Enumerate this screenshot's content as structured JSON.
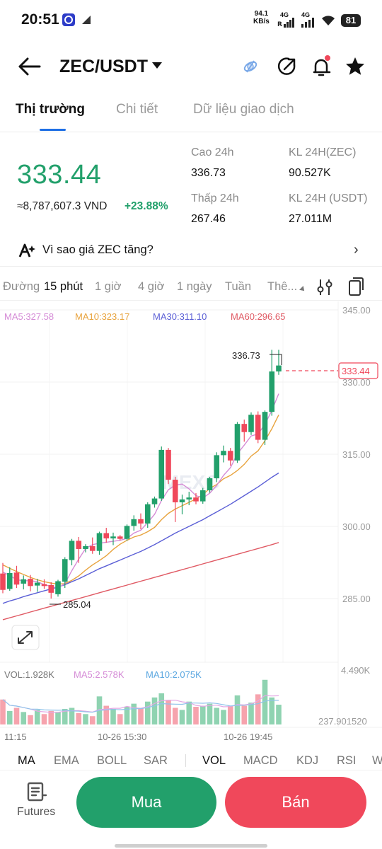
{
  "status_bar": {
    "time": "20:51",
    "net_speed": "94.1",
    "net_unit": "KB/s",
    "sig1": "4G",
    "sig2": "4G",
    "battery": "81"
  },
  "header": {
    "pair": "ZEC/USDT"
  },
  "tabs": [
    {
      "label": "Thị trường"
    },
    {
      "label": "Chi tiết"
    },
    {
      "label": "Dữ liệu giao dịch"
    }
  ],
  "price": {
    "last": "333.44",
    "vnd": "≈8,787,607.3 VND",
    "change": "+23.88%",
    "high_label": "Cao 24h",
    "high": "336.73",
    "low_label": "Thấp 24h",
    "low": "267.46",
    "vol_base_label": "KL 24H(ZEC)",
    "vol_base": "90.527K",
    "vol_quote_label": "KL 24H (USDT)",
    "vol_quote": "27.011M"
  },
  "why_banner": "Vì sao giá ZEC tăng?",
  "intervals": [
    "Đường",
    "15 phút",
    "1 giờ",
    "4 giờ",
    "1 ngày",
    "Tuần",
    "Thê..."
  ],
  "chart_labels": {
    "ma5": "MA5:327.58",
    "ma10": "MA10:323.17",
    "ma30": "MA30:311.10",
    "ma60": "MA60:296.65",
    "high_mark": "336.73",
    "low_mark": "285.04",
    "price_tag": "333.44",
    "vol": "VOL:1.928K",
    "vol_ma5": "MA5:2.578K",
    "vol_ma10": "MA10:2.075K",
    "vol_max": "4.490K",
    "vol_min": "237.901520",
    "watermark": "MEXC"
  },
  "chart_data": {
    "type": "candlestick",
    "y_ticks": [
      "345.00",
      "330.00",
      "315.00",
      "300.00",
      "285.00"
    ],
    "ylim": [
      277.5,
      345
    ],
    "x_ticks": [
      "11:15",
      "10-26 15:30",
      "10-26 19:45"
    ],
    "candles": [
      {
        "o": 290.2,
        "h": 292.4,
        "l": 286.1,
        "c": 286.8
      },
      {
        "o": 287.0,
        "h": 291.5,
        "l": 286.6,
        "c": 290.3
      },
      {
        "o": 290.4,
        "h": 291.8,
        "l": 287.2,
        "c": 287.9
      },
      {
        "o": 288.1,
        "h": 289.8,
        "l": 286.9,
        "c": 289.0
      },
      {
        "o": 289.1,
        "h": 289.9,
        "l": 286.5,
        "c": 287.6
      },
      {
        "o": 287.7,
        "h": 289.1,
        "l": 286.4,
        "c": 288.3
      },
      {
        "o": 288.0,
        "h": 289.0,
        "l": 287.0,
        "c": 287.6
      },
      {
        "o": 287.8,
        "h": 288.4,
        "l": 285.0,
        "c": 286.2
      },
      {
        "o": 285.9,
        "h": 288.9,
        "l": 285.4,
        "c": 288.6
      },
      {
        "o": 288.5,
        "h": 293.6,
        "l": 287.2,
        "c": 293.2
      },
      {
        "o": 293.0,
        "h": 297.4,
        "l": 291.9,
        "c": 297.0
      },
      {
        "o": 297.0,
        "h": 297.8,
        "l": 292.4,
        "c": 295.3
      },
      {
        "o": 295.3,
        "h": 296.3,
        "l": 294.6,
        "c": 295.9
      },
      {
        "o": 295.9,
        "h": 297.7,
        "l": 294.3,
        "c": 294.9
      },
      {
        "o": 294.9,
        "h": 298.9,
        "l": 294.1,
        "c": 298.6
      },
      {
        "o": 298.6,
        "h": 299.7,
        "l": 296.6,
        "c": 297.5
      },
      {
        "o": 297.5,
        "h": 298.7,
        "l": 296.1,
        "c": 297.9
      },
      {
        "o": 297.9,
        "h": 298.2,
        "l": 297.1,
        "c": 297.4
      },
      {
        "o": 297.4,
        "h": 300.4,
        "l": 297.0,
        "c": 300.1
      },
      {
        "o": 300.1,
        "h": 302.3,
        "l": 299.1,
        "c": 301.5
      },
      {
        "o": 301.5,
        "h": 302.7,
        "l": 299.4,
        "c": 300.6
      },
      {
        "o": 300.6,
        "h": 305.0,
        "l": 299.7,
        "c": 304.6
      },
      {
        "o": 304.6,
        "h": 306.2,
        "l": 303.9,
        "c": 305.8
      },
      {
        "o": 305.8,
        "h": 316.6,
        "l": 305.3,
        "c": 315.9
      },
      {
        "o": 315.9,
        "h": 316.3,
        "l": 308.8,
        "c": 309.7
      },
      {
        "o": 309.7,
        "h": 310.3,
        "l": 300.9,
        "c": 305.0
      },
      {
        "o": 305.0,
        "h": 306.6,
        "l": 302.5,
        "c": 305.6
      },
      {
        "o": 305.6,
        "h": 307.2,
        "l": 304.4,
        "c": 306.0
      },
      {
        "o": 306.0,
        "h": 306.9,
        "l": 304.6,
        "c": 305.2
      },
      {
        "o": 305.2,
        "h": 308.0,
        "l": 304.7,
        "c": 307.5
      },
      {
        "o": 307.5,
        "h": 310.3,
        "l": 307.0,
        "c": 310.0
      },
      {
        "o": 310.0,
        "h": 315.4,
        "l": 309.2,
        "c": 314.8
      },
      {
        "o": 314.8,
        "h": 316.8,
        "l": 313.3,
        "c": 315.7
      },
      {
        "o": 315.7,
        "h": 316.3,
        "l": 312.6,
        "c": 313.7
      },
      {
        "o": 313.7,
        "h": 321.7,
        "l": 313.2,
        "c": 321.3
      },
      {
        "o": 321.3,
        "h": 322.2,
        "l": 317.6,
        "c": 319.6
      },
      {
        "o": 319.6,
        "h": 323.7,
        "l": 319.0,
        "c": 323.2
      },
      {
        "o": 323.2,
        "h": 323.9,
        "l": 317.3,
        "c": 318.0
      },
      {
        "o": 318.0,
        "h": 324.1,
        "l": 316.9,
        "c": 323.8
      },
      {
        "o": 323.8,
        "h": 336.7,
        "l": 323.0,
        "c": 332.2
      },
      {
        "o": 332.2,
        "h": 336.7,
        "l": 331.5,
        "c": 333.44
      }
    ],
    "volume": [
      2.4,
      1.3,
      1.6,
      1.2,
      0.9,
      1.4,
      1.0,
      1.3,
      1.2,
      1.5,
      1.6,
      1.1,
      1.0,
      0.8,
      2.7,
      1.8,
      1.5,
      1.0,
      1.7,
      2.0,
      1.6,
      2.2,
      2.6,
      3.0,
      2.3,
      1.6,
      1.4,
      2.2,
      1.7,
      1.8,
      2.0,
      1.6,
      1.4,
      1.8,
      2.8,
      1.8,
      2.1,
      2.9,
      4.3,
      2.6,
      1.9
    ],
    "ma5": [
      290.5,
      289.8,
      288.9,
      288.7,
      288.7,
      288.5,
      287.9,
      287.5,
      287.2,
      288.1,
      290.8,
      293.2,
      295.4,
      296.2,
      296.5,
      296.7,
      296.9,
      297.1,
      297.5,
      298.6,
      299.2,
      300.8,
      302.5,
      305.4,
      307.6,
      308.6,
      308.8,
      307.8,
      306.4,
      305.9,
      306.9,
      308.5,
      310.6,
      312.2,
      315.1,
      316.9,
      318.8,
      319.2,
      321.2,
      324.1,
      327.58
    ],
    "ma10": [
      292.0,
      291.3,
      290.6,
      290.0,
      289.4,
      288.9,
      288.5,
      288.2,
      288.0,
      288.1,
      288.8,
      289.7,
      290.9,
      292.0,
      292.9,
      293.9,
      295.2,
      296.3,
      297.1,
      297.8,
      298.2,
      298.9,
      299.8,
      301.4,
      302.7,
      303.6,
      304.3,
      305.0,
      305.7,
      306.6,
      307.9,
      308.7,
      309.9,
      310.6,
      311.6,
      312.9,
      314.6,
      315.7,
      317.8,
      320.3,
      323.17
    ],
    "ma30": [
      284.0,
      284.5,
      284.9,
      285.4,
      285.8,
      286.2,
      286.6,
      287.0,
      287.4,
      287.9,
      288.5,
      289.1,
      289.8,
      290.5,
      291.2,
      291.8,
      292.4,
      293.0,
      293.6,
      294.2,
      294.8,
      295.5,
      296.2,
      297.0,
      297.8,
      298.6,
      299.3,
      300.0,
      300.7,
      301.4,
      302.2,
      303.0,
      303.8,
      304.6,
      305.5,
      306.4,
      307.3,
      308.2,
      309.2,
      310.2,
      311.1
    ],
    "ma60": [
      280.6,
      281.0,
      281.4,
      281.8,
      282.2,
      282.6,
      283.0,
      283.4,
      283.8,
      284.2,
      284.6,
      285.0,
      285.4,
      285.8,
      286.2,
      286.6,
      287.0,
      287.4,
      287.8,
      288.2,
      288.6,
      289.0,
      289.4,
      289.8,
      290.2,
      290.6,
      291.0,
      291.4,
      291.8,
      292.2,
      292.6,
      293.0,
      293.4,
      293.8,
      294.2,
      294.6,
      295.0,
      295.4,
      295.8,
      296.2,
      296.65
    ]
  },
  "indicators": [
    "MA",
    "EMA",
    "BOLL",
    "SAR",
    "VOL",
    "MACD",
    "KDJ",
    "RSI",
    "W"
  ],
  "bottom": {
    "futures": "Futures",
    "buy": "Mua",
    "sell": "Bán"
  },
  "colors": {
    "up": "#22a06b",
    "down": "#f0485b",
    "ma5": "#d58bd6",
    "ma10": "#e8a33d",
    "ma30": "#5b5fd6",
    "ma60": "#e05a64",
    "accent": "#1f6fe5"
  }
}
